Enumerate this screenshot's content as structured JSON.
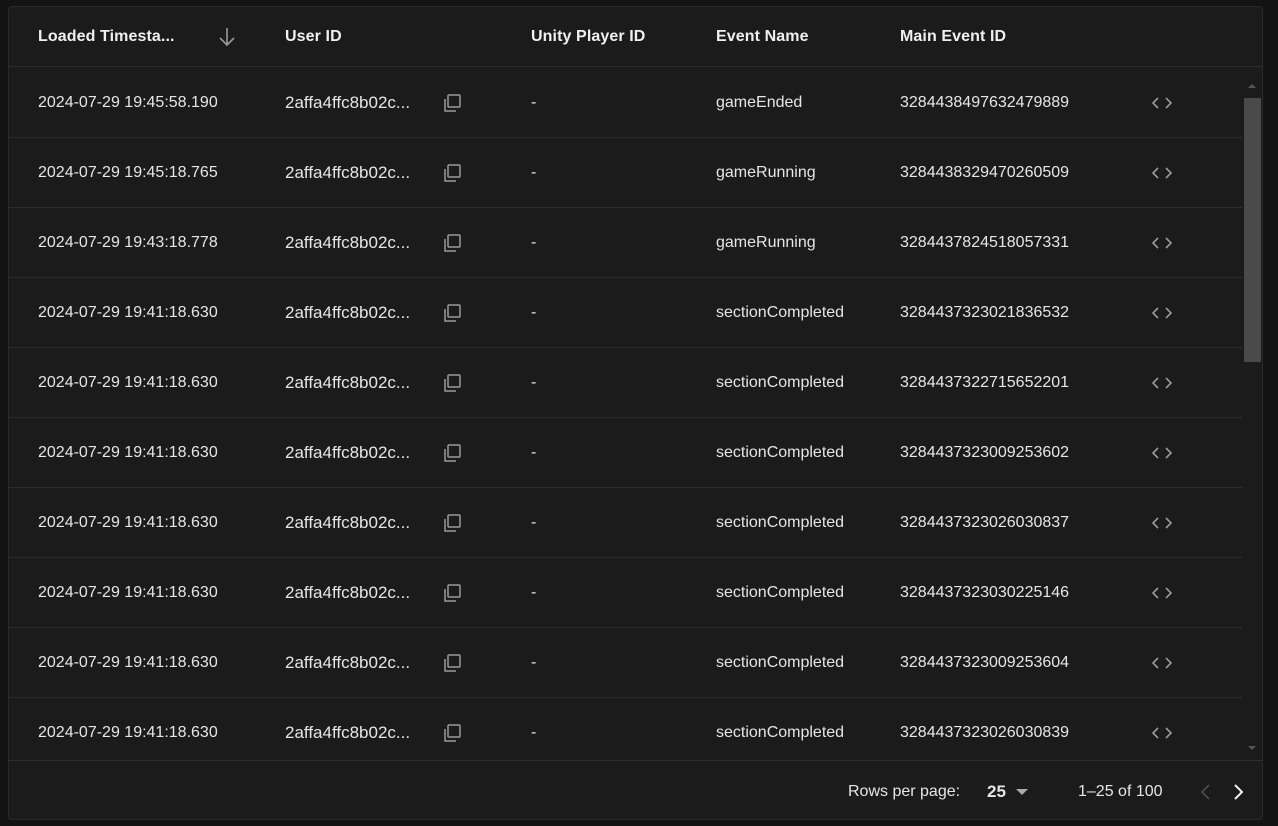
{
  "table": {
    "columns": [
      {
        "label": "Loaded Timesta..."
      },
      {
        "label": "User ID"
      },
      {
        "label": "Unity Player ID"
      },
      {
        "label": "Event Name"
      },
      {
        "label": "Main Event ID"
      }
    ],
    "rows": [
      {
        "timestamp": "2024-07-29 19:45:58.190",
        "user_id": "2affa4ffc8b02c...",
        "unity_player_id": "-",
        "event_name": "gameEnded",
        "main_event_id": "3284438497632479889"
      },
      {
        "timestamp": "2024-07-29 19:45:18.765",
        "user_id": "2affa4ffc8b02c...",
        "unity_player_id": "-",
        "event_name": "gameRunning",
        "main_event_id": "3284438329470260509"
      },
      {
        "timestamp": "2024-07-29 19:43:18.778",
        "user_id": "2affa4ffc8b02c...",
        "unity_player_id": "-",
        "event_name": "gameRunning",
        "main_event_id": "3284437824518057331"
      },
      {
        "timestamp": "2024-07-29 19:41:18.630",
        "user_id": "2affa4ffc8b02c...",
        "unity_player_id": "-",
        "event_name": "sectionCompleted",
        "main_event_id": "3284437323021836532"
      },
      {
        "timestamp": "2024-07-29 19:41:18.630",
        "user_id": "2affa4ffc8b02c...",
        "unity_player_id": "-",
        "event_name": "sectionCompleted",
        "main_event_id": "3284437322715652201"
      },
      {
        "timestamp": "2024-07-29 19:41:18.630",
        "user_id": "2affa4ffc8b02c...",
        "unity_player_id": "-",
        "event_name": "sectionCompleted",
        "main_event_id": "3284437323009253602"
      },
      {
        "timestamp": "2024-07-29 19:41:18.630",
        "user_id": "2affa4ffc8b02c...",
        "unity_player_id": "-",
        "event_name": "sectionCompleted",
        "main_event_id": "3284437323026030837"
      },
      {
        "timestamp": "2024-07-29 19:41:18.630",
        "user_id": "2affa4ffc8b02c...",
        "unity_player_id": "-",
        "event_name": "sectionCompleted",
        "main_event_id": "3284437323030225146"
      },
      {
        "timestamp": "2024-07-29 19:41:18.630",
        "user_id": "2affa4ffc8b02c...",
        "unity_player_id": "-",
        "event_name": "sectionCompleted",
        "main_event_id": "3284437323009253604"
      },
      {
        "timestamp": "2024-07-29 19:41:18.630",
        "user_id": "2affa4ffc8b02c...",
        "unity_player_id": "-",
        "event_name": "sectionCompleted",
        "main_event_id": "3284437323026030839"
      }
    ],
    "row_icons": {
      "copy": "copy-icon",
      "code": "code-icon"
    },
    "sort_icon": "arrow-down-icon"
  },
  "pagination": {
    "rows_per_page_label": "Rows per page:",
    "rows_per_page_value": "25",
    "range_text": "1–25 of 100",
    "prev_icon": "chevron-left-icon",
    "next_icon": "chevron-right-icon"
  },
  "colors": {
    "background": "#1b1b1b",
    "border": "#2c2c2c",
    "text": "#e6e6e6",
    "muted_icon": "#9a9a9a"
  }
}
